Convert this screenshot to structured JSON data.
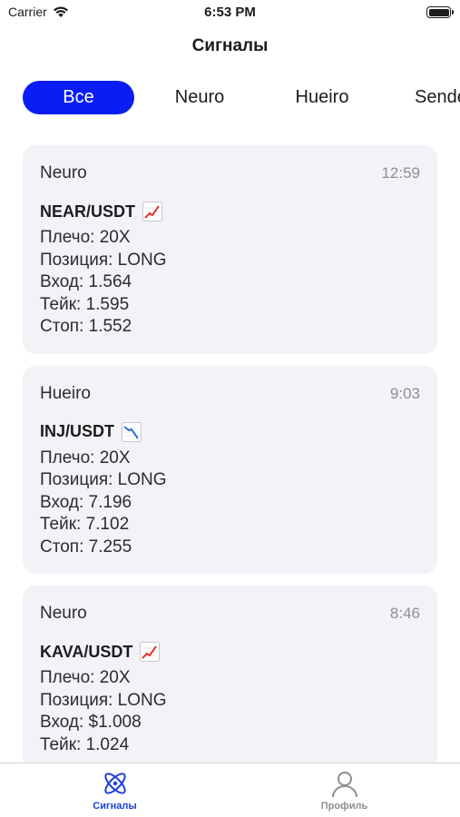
{
  "status_bar": {
    "carrier": "Carrier",
    "time": "6:53 PM"
  },
  "header": {
    "title": "Сигналы"
  },
  "filters": [
    {
      "label": "Все",
      "active": true
    },
    {
      "label": "Neuro",
      "active": false
    },
    {
      "label": "Hueiro",
      "active": false
    },
    {
      "label": "Sende",
      "active": false
    }
  ],
  "signals": [
    {
      "source": "Neuro",
      "time": "12:59",
      "pair": "NEAR/USDT",
      "trend_icon": "chart-up-icon",
      "lines": [
        "Плечо: 20X",
        "Позиция: LONG",
        "Вход: 1.564",
        "Тейк: 1.595",
        "Стоп: 1.552"
      ]
    },
    {
      "source": "Hueiro",
      "time": "9:03",
      "pair": "INJ/USDT",
      "trend_icon": "chart-down-icon",
      "lines": [
        "Плечо: 20X",
        "Позиция: LONG",
        "Вход: 7.196",
        "Тейк: 7.102",
        "Стоп: 7.255"
      ]
    },
    {
      "source": "Neuro",
      "time": "8:46",
      "pair": "KAVA/USDT",
      "trend_icon": "chart-up-icon",
      "lines": [
        "Плечо: 20X",
        "Позиция: LONG",
        "Вход: $1.008",
        "Тейк: 1.024"
      ]
    }
  ],
  "tab_bar": {
    "tabs": [
      {
        "label": "Сигналы",
        "icon": "atom-icon",
        "active": true
      },
      {
        "label": "Профиль",
        "icon": "person-icon",
        "active": false
      }
    ]
  },
  "colors": {
    "accent": "#0a1df5",
    "tab_active": "#1a3fd6",
    "card_bg": "#f2f2f7"
  }
}
